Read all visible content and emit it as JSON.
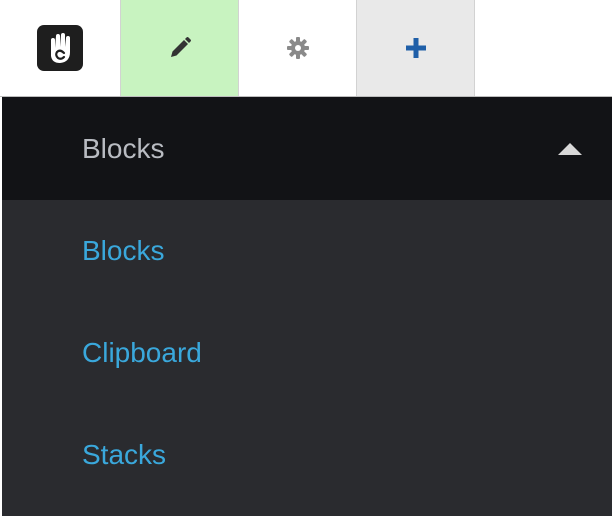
{
  "toolbar": {
    "logo_icon": "concrete5-hand-logo-icon",
    "edit_icon": "pencil-icon",
    "settings_icon": "gear-icon",
    "add_icon": "plus-icon",
    "colors": {
      "edit_active_bg": "#c8f3c0",
      "add_bg": "#e9e9e9",
      "icon": "#333333",
      "add_icon": "#1f5fa8"
    }
  },
  "panel": {
    "header_title": "Blocks",
    "items": [
      {
        "label": "Blocks"
      },
      {
        "label": "Clipboard"
      },
      {
        "label": "Stacks"
      }
    ],
    "colors": {
      "background": "#2a2b2f",
      "header_background": "#121316",
      "link": "#3aa8dc"
    }
  }
}
